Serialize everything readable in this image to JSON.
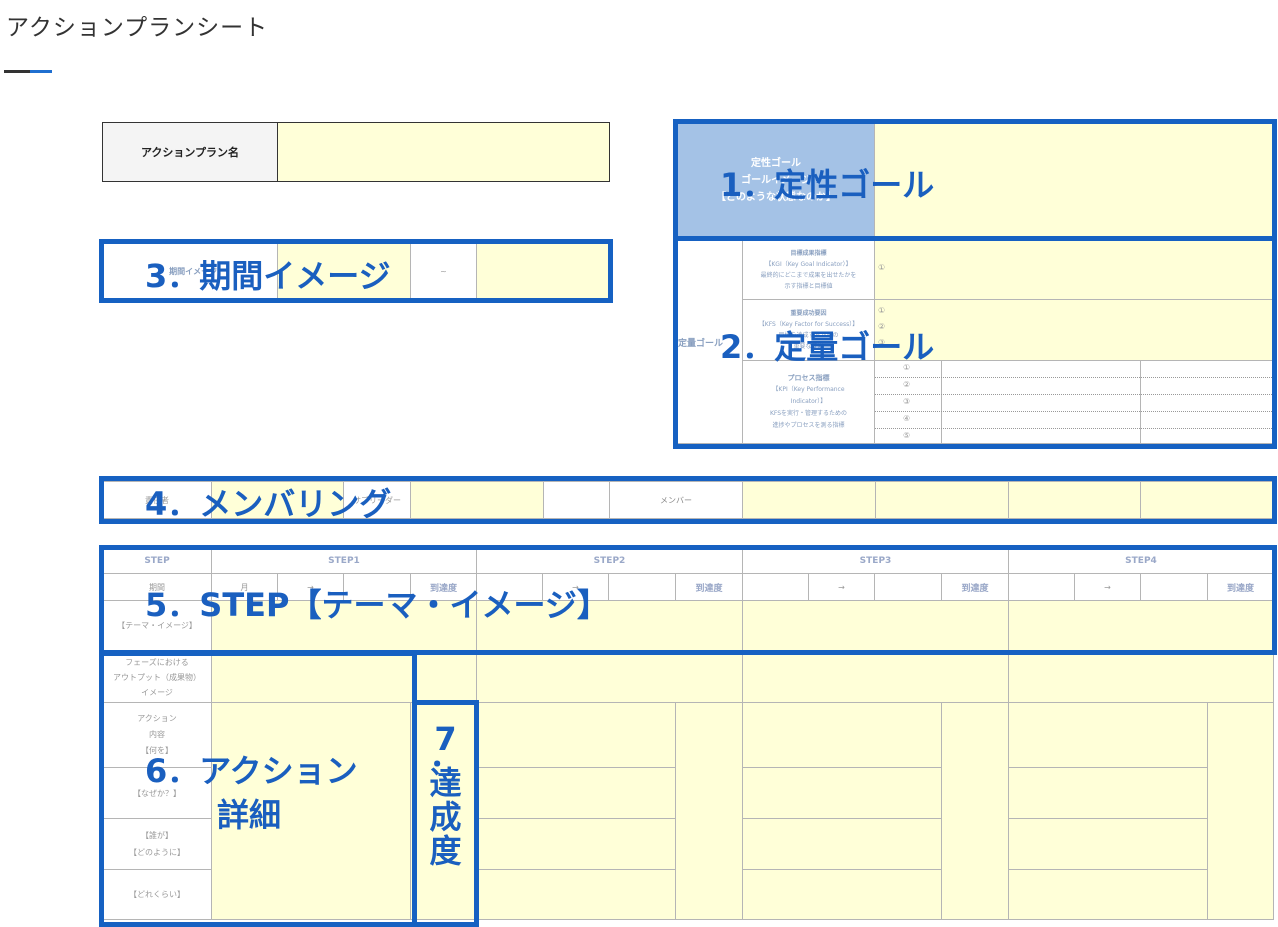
{
  "page": {
    "title": "アクションプランシート"
  },
  "plan_name": {
    "label": "アクションプラン名"
  },
  "qualitative": {
    "label_line1": "定性ゴール",
    "label_line2": "ゴールイメージ",
    "label_line3": "【どのような状態なのか】"
  },
  "period": {
    "label": "期間イメージ",
    "separator": "~"
  },
  "quantitative": {
    "label": "定量ゴール",
    "kgi": {
      "title": "目標成果指標",
      "sub1": "【KGI（Key Goal Indicator）】",
      "sub2": "最終的にどこまで成果を出せたかを",
      "sub3": "示す指標と目標値",
      "marks": [
        "①"
      ]
    },
    "kfs": {
      "title": "重要成功要因",
      "sub1": "【KFS（Key Factor for Success）】",
      "sub2": "目標を達成するための",
      "sub3": "重要な要因",
      "marks": [
        "①",
        "②",
        "③"
      ]
    },
    "kpi": {
      "title": "プロセス指標",
      "sub1": "【KPI（Key Performance",
      "sub2": "Indicator）】",
      "sub3": "KFSを実行・管理するための",
      "sub4": "進捗やプロセスを測る指標",
      "marks": [
        "①",
        "②",
        "③",
        "④",
        "⑤"
      ]
    }
  },
  "members": {
    "leader_label": "責任者",
    "sub_label": "サブリーダー",
    "member_label": "メンバー"
  },
  "steps": {
    "header": "STEP",
    "names": [
      "STEP1",
      "STEP2",
      "STEP3",
      "STEP4"
    ],
    "period_label": "期間",
    "arrow": "→",
    "achieve_label": "到達度",
    "month_label": "月",
    "theme_label": "【テーマ・イメージ】"
  },
  "rows": {
    "output": [
      "フェーズにおける",
      "アウトプット（成果物）",
      "イメージ"
    ],
    "action": [
      "アクション",
      "内容",
      "【何を】"
    ],
    "why": "【なぜか？】",
    "who": [
      "【誰が】",
      "【どのように】"
    ],
    "how_much": "【どれくらい】"
  },
  "overlays": {
    "o1": "1．定性ゴール",
    "o2": "2．定量ゴール",
    "o3": "3．期間イメージ",
    "o4": "4．メンバリング",
    "o5": "5．STEP【テーマ・イメージ】",
    "o6_line1": "6．アクション",
    "o6_line2": "詳細",
    "o7": [
      "7",
      "．",
      "達",
      "成",
      "度"
    ]
  }
}
